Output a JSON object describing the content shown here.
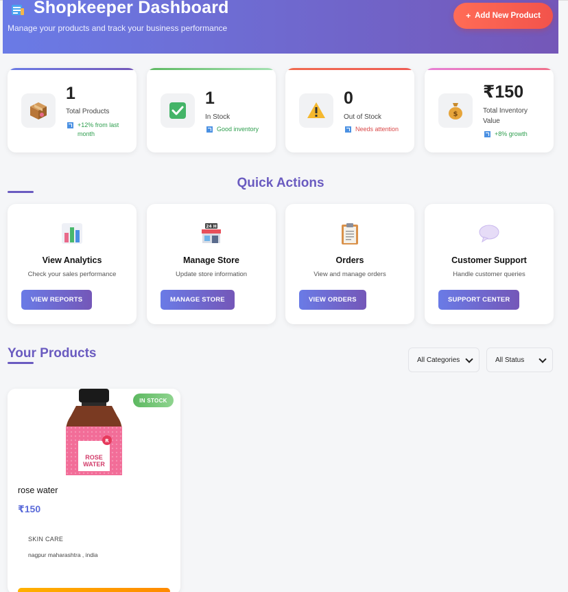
{
  "header": {
    "icon": "notepad-icon",
    "title": "Shopkeeper Dashboard",
    "subtitle": "Manage your products and track your business performance",
    "add_button": {
      "icon": "plus-icon",
      "label": "Add New Product"
    }
  },
  "stats": [
    {
      "icon": "package-icon",
      "value": "1",
      "label": "Total Products",
      "trend": "+12% from last month",
      "trend_icon": "trend-up-icon",
      "accent": "#7b5fc0",
      "trend_color": "green"
    },
    {
      "icon": "check-icon",
      "value": "1",
      "label": "In Stock",
      "trend": "Good inventory",
      "trend_icon": "trend-up-icon",
      "accent": "#6cc784",
      "trend_color": "green"
    },
    {
      "icon": "warning-icon",
      "value": "0",
      "label": "Out of Stock",
      "trend": "Needs attention",
      "trend_icon": "trend-down-icon",
      "accent": "#f0604e",
      "trend_color": "red"
    },
    {
      "icon": "money-bag-icon",
      "value": "₹150",
      "label": "Total Inventory Value",
      "trend": "+8% growth",
      "trend_icon": "trend-up-icon",
      "accent": "#e07ad8",
      "trend_color": "green"
    }
  ],
  "quick_actions": {
    "title": "Quick Actions",
    "items": [
      {
        "icon": "bar-chart-icon",
        "name": "View Analytics",
        "desc": "Check your sales performance",
        "button": "VIEW REPORTS"
      },
      {
        "icon": "store-icon",
        "name": "Manage Store",
        "desc": "Update store information",
        "button": "MANAGE STORE",
        "icon_text": "24 H"
      },
      {
        "icon": "clipboard-icon",
        "name": "Orders",
        "desc": "View and manage orders",
        "button": "VIEW ORDERS"
      },
      {
        "icon": "speech-bubble-icon",
        "name": "Customer Support",
        "desc": "Handle customer queries",
        "button": "SUPPORT CENTER"
      }
    ]
  },
  "products": {
    "title": "Your Products",
    "filters": {
      "category": "All Categories",
      "status": "All Status"
    },
    "items": [
      {
        "image": "rose-water-bottle",
        "badge": "IN STOCK",
        "name": "rose water",
        "price": "₹150",
        "category": "SKIN CARE",
        "location": "nagpur maharashtra , india",
        "label_lines": [
          "ROSE",
          "WATER"
        ],
        "brand_mark": "R"
      }
    ]
  },
  "colors": {
    "primary": "#6a7be6",
    "secondary": "#7457b8",
    "accent_red": "#f2534b",
    "price": "#5b6bd9"
  }
}
